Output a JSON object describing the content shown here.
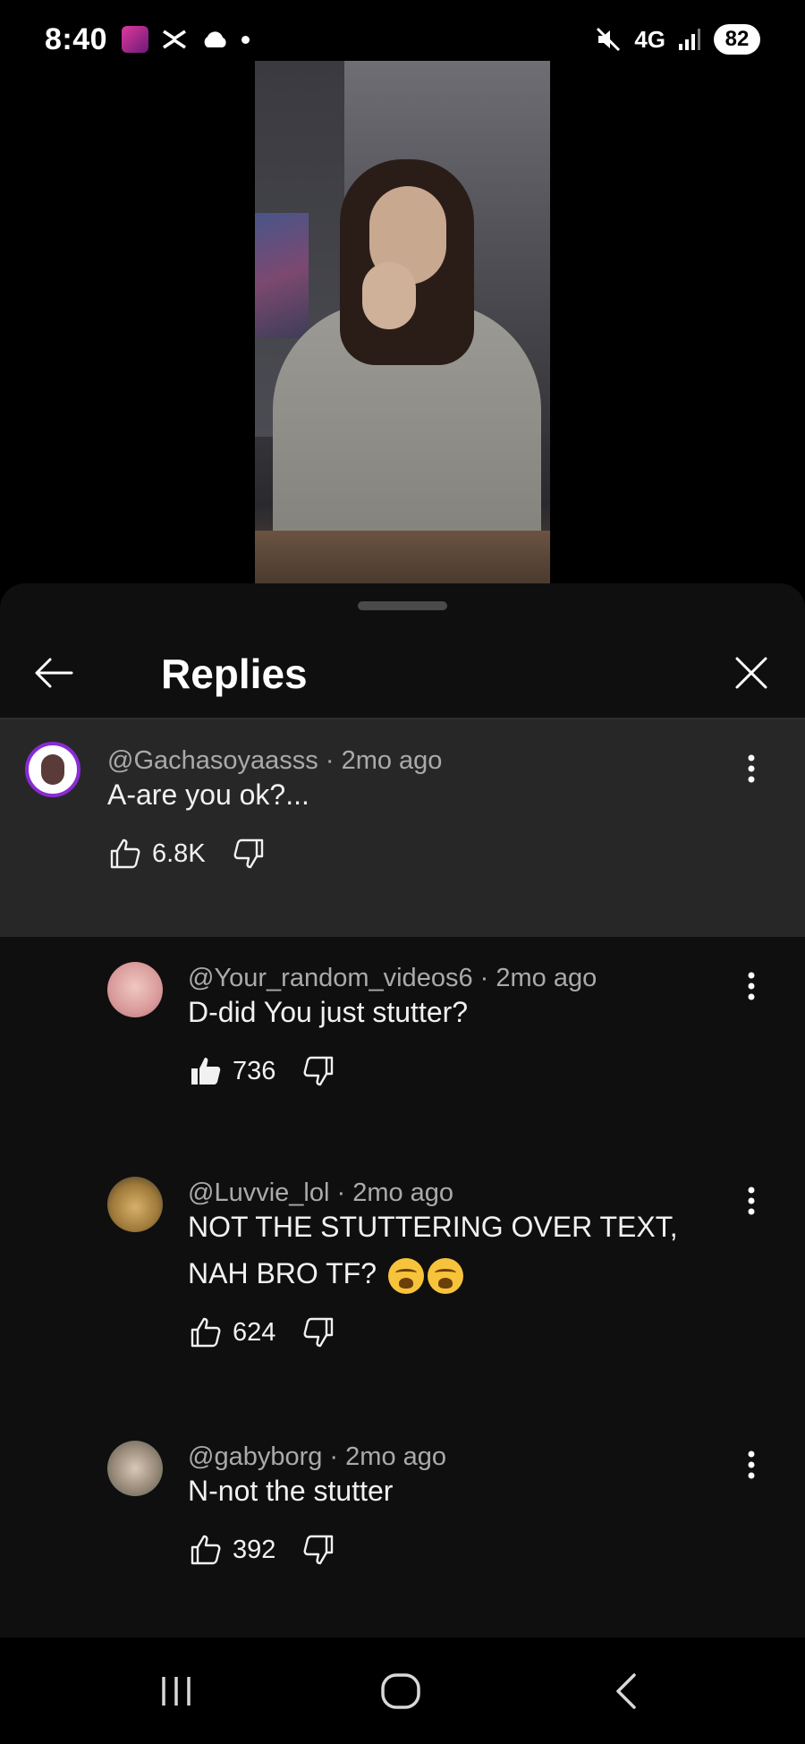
{
  "status_bar": {
    "time": "8:40",
    "network": "4G",
    "battery": "82"
  },
  "sheet": {
    "title": "Replies"
  },
  "parent_comment": {
    "handle": "@Gachasoyaasss",
    "age": "2mo ago",
    "text": "A-are you ok?...",
    "likes": "6.8K",
    "liked": false
  },
  "replies": [
    {
      "handle": "@Your_random_videos6",
      "age": "2mo ago",
      "text": "D-did You just stutter?",
      "likes": "736",
      "liked": true
    },
    {
      "handle": "@Luvvie_lol",
      "age": "2mo ago",
      "text_line1": "NOT THE STUTTERING OVER TEXT,",
      "text_line2": "NAH BRO TF?",
      "emoji": "loudly-crying-face x2",
      "likes": "624",
      "liked": false
    },
    {
      "handle": "@gabyborg",
      "age": "2mo ago",
      "text": "N-not the stutter",
      "likes": "392",
      "liked": false
    }
  ],
  "colors": {
    "sheet_bg": "#0f0f0f",
    "parent_bg": "#272727",
    "meta_text": "#aaaaaa",
    "avatar_ring": "#8a2bd6"
  }
}
